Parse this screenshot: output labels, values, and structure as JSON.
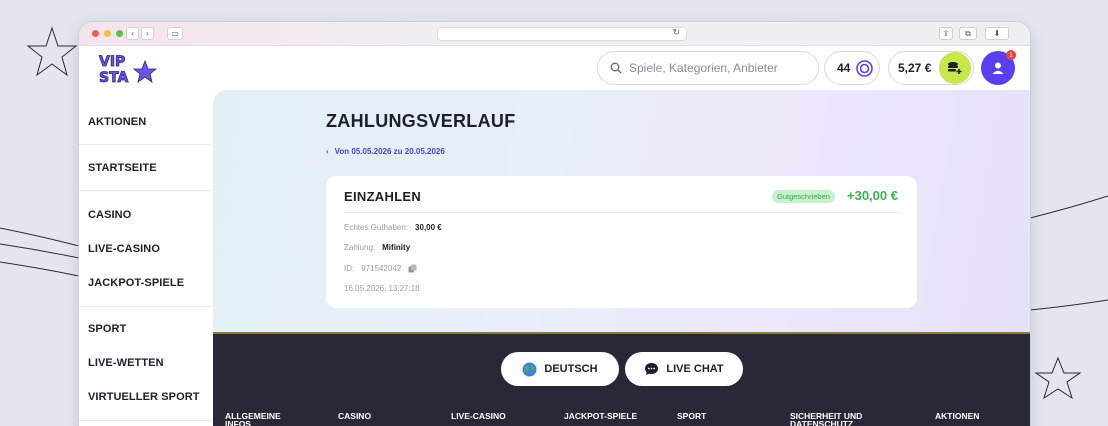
{
  "browser": {
    "url_hidden": ""
  },
  "header": {
    "logo_text": "VIP STA",
    "search_placeholder": "Spiele, Kategorien, Anbieter",
    "coins": "44",
    "balance": "5,27 €",
    "notification_count": "1"
  },
  "sidebar": {
    "items": [
      {
        "label": "AKTIONEN"
      },
      {
        "label": "STARTSEITE"
      },
      {
        "label": "CASINO"
      },
      {
        "label": "LIVE-CASINO"
      },
      {
        "label": "JACKPOT-SPIELE"
      },
      {
        "label": "SPORT"
      },
      {
        "label": "LIVE-WETTEN"
      },
      {
        "label": "VIRTUELLER SPORT"
      }
    ]
  },
  "main": {
    "title": "ZAHLUNGSVERLAUF",
    "date_range": "Von 05.05.2026 zu 20.05.2026",
    "transaction": {
      "type": "EINZAHLEN",
      "status": "Gutgeschrieben",
      "amount": "+30,00 €",
      "balance_label": "Echtes Guthaben:",
      "balance_value": "30,00 €",
      "payment_label": "Zahlung:",
      "payment_value": "Mifinity",
      "id_label": "ID:",
      "id_value": "971542042",
      "datetime": "16.05.2026, 13:27:18"
    }
  },
  "footer": {
    "language_button": "DEUTSCH",
    "chat_button": "LIVE CHAT",
    "columns": [
      "ALLGEMEINE INFOS",
      "CASINO",
      "LIVE-CASINO",
      "JACKPOT-SPIELE",
      "SPORT",
      "SICHERHEIT UND DATENSCHUTZ",
      "AKTIONEN"
    ]
  },
  "colors": {
    "accent": "#4b3fd6",
    "success": "#3cb34f",
    "wallet": "#c6e84a",
    "avatar": "#5a3ef0",
    "footer": "#2a2836"
  }
}
